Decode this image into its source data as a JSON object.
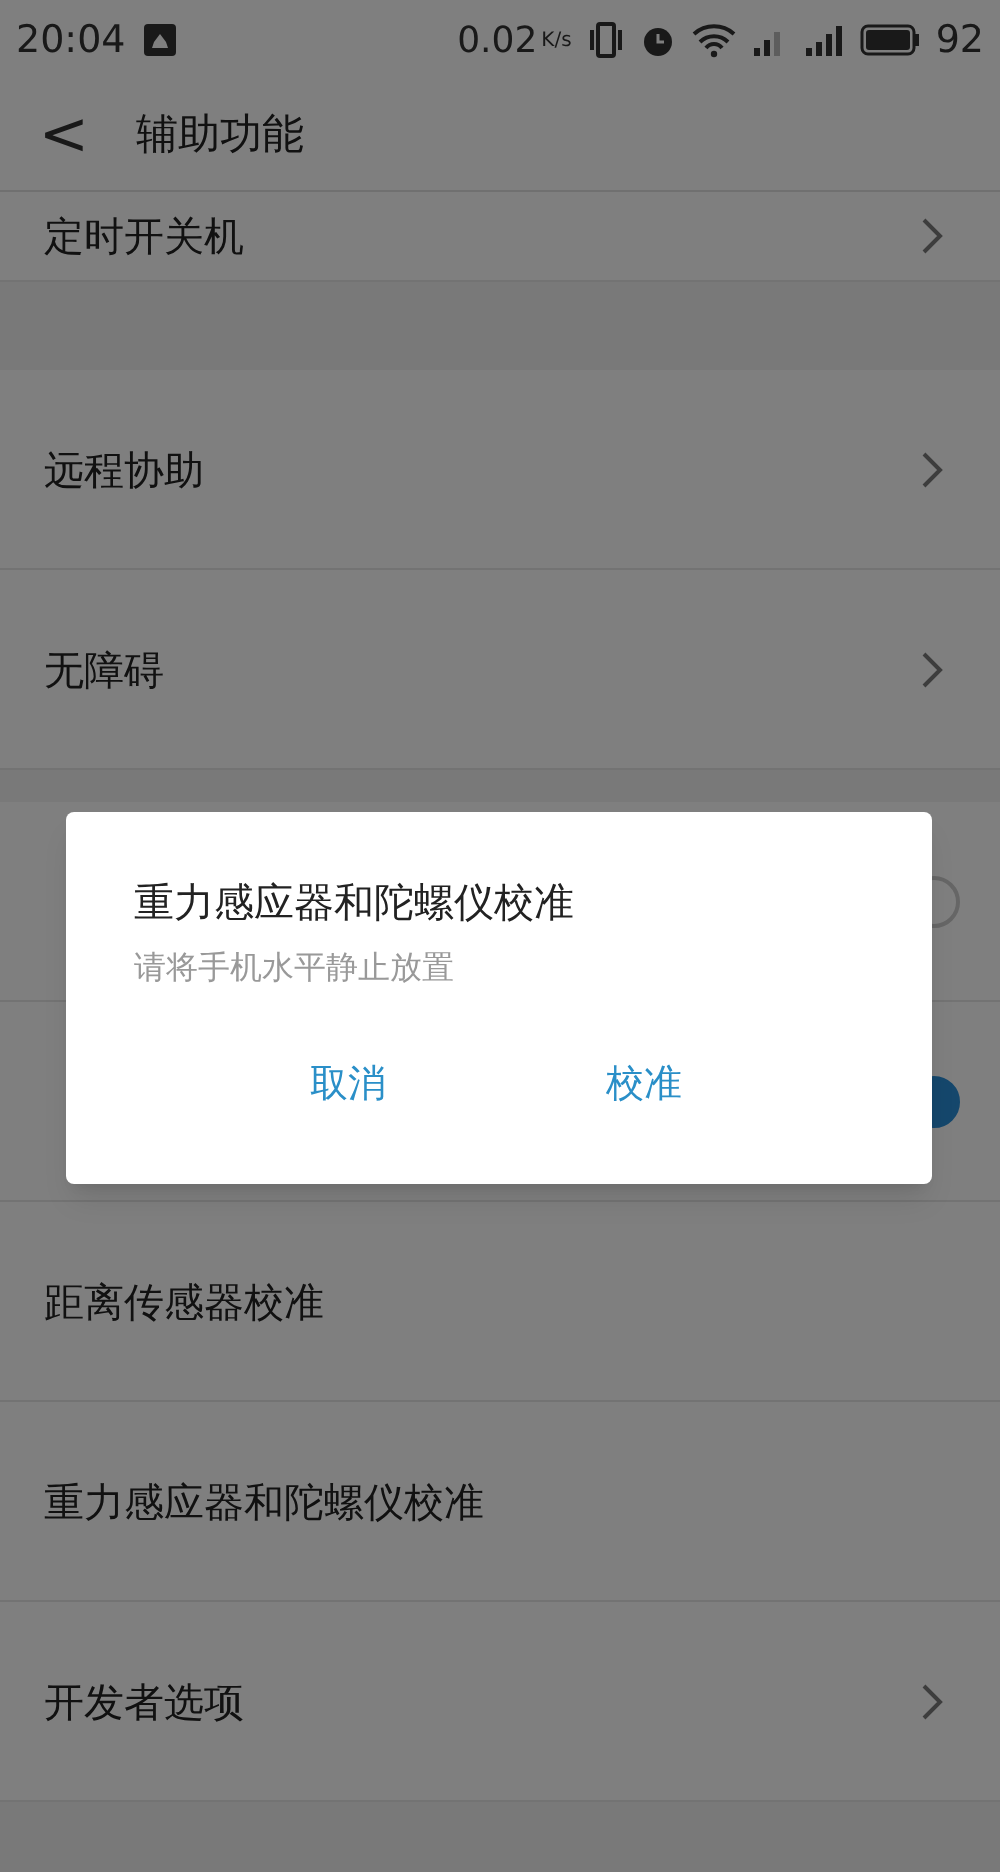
{
  "status_bar": {
    "time": "20:04",
    "speed": "0.02",
    "speed_unit": "K/s",
    "battery": "92"
  },
  "header": {
    "back": "<",
    "title": "辅助功能"
  },
  "sections": [
    {
      "rows": [
        {
          "kind": "link",
          "title": "定时开关机"
        }
      ]
    },
    {
      "rows": [
        {
          "kind": "link",
          "title": "远程协助"
        },
        {
          "kind": "link",
          "title": "无障碍"
        }
      ]
    },
    {
      "rows": [
        {
          "kind": "toggle",
          "on": false
        },
        {
          "kind": "toggle",
          "on": true
        },
        {
          "kind": "plain",
          "title": "距离传感器校准"
        },
        {
          "kind": "plain",
          "title": "重力感应器和陀螺仪校准"
        },
        {
          "kind": "link",
          "title": "开发者选项"
        }
      ]
    }
  ],
  "dialog": {
    "title": "重力感应器和陀螺仪校准",
    "message": "请将手机水平静止放置",
    "buttons": [
      "取消",
      "校准"
    ]
  }
}
